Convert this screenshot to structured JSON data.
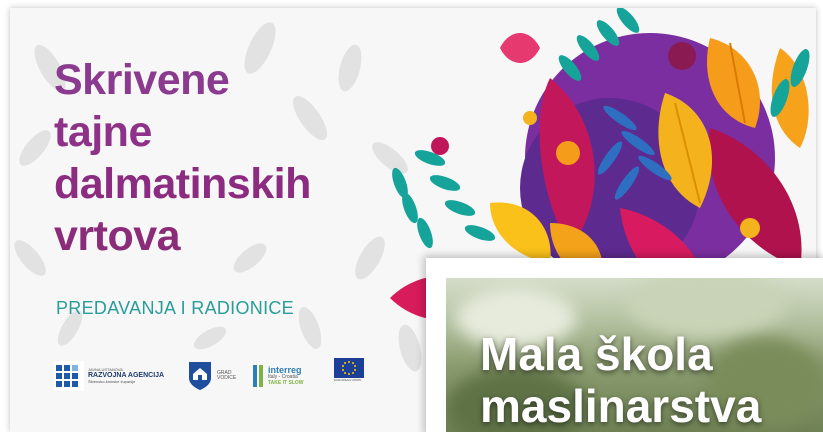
{
  "poster": {
    "title_lines": [
      "Skrivene",
      "tajne",
      "dalmatinskih",
      "vrtova"
    ],
    "subtitle": "PREDAVANJA I RADIONICE",
    "logos": {
      "agency_small": "JAVNA USTANOVA",
      "agency_big_1": "RAZVOJNA AGENCIJA",
      "agency_sub": "Šibensko-kninske županije",
      "grad_line_1": "GRAD",
      "grad_line_2": "VODICE",
      "interreg_brand": "interreg",
      "interreg_line": "Italy - Croatia",
      "interreg_slogan": "TAKE IT SLOW",
      "eu_label": "EUROPEAN UNION"
    }
  },
  "inset": {
    "title_lines": [
      "Mala škola",
      "maslinarstva"
    ]
  },
  "colors": {
    "title": "#8a2f86",
    "subtitle": "#2a9d9a",
    "poster_bg": "#f7f7f7",
    "photo_text": "#ffffff"
  },
  "icons": [
    "leaf-icon",
    "flower-icon",
    "agency-logo-icon",
    "city-crest-icon",
    "interreg-logo-icon",
    "eu-flag-icon"
  ]
}
